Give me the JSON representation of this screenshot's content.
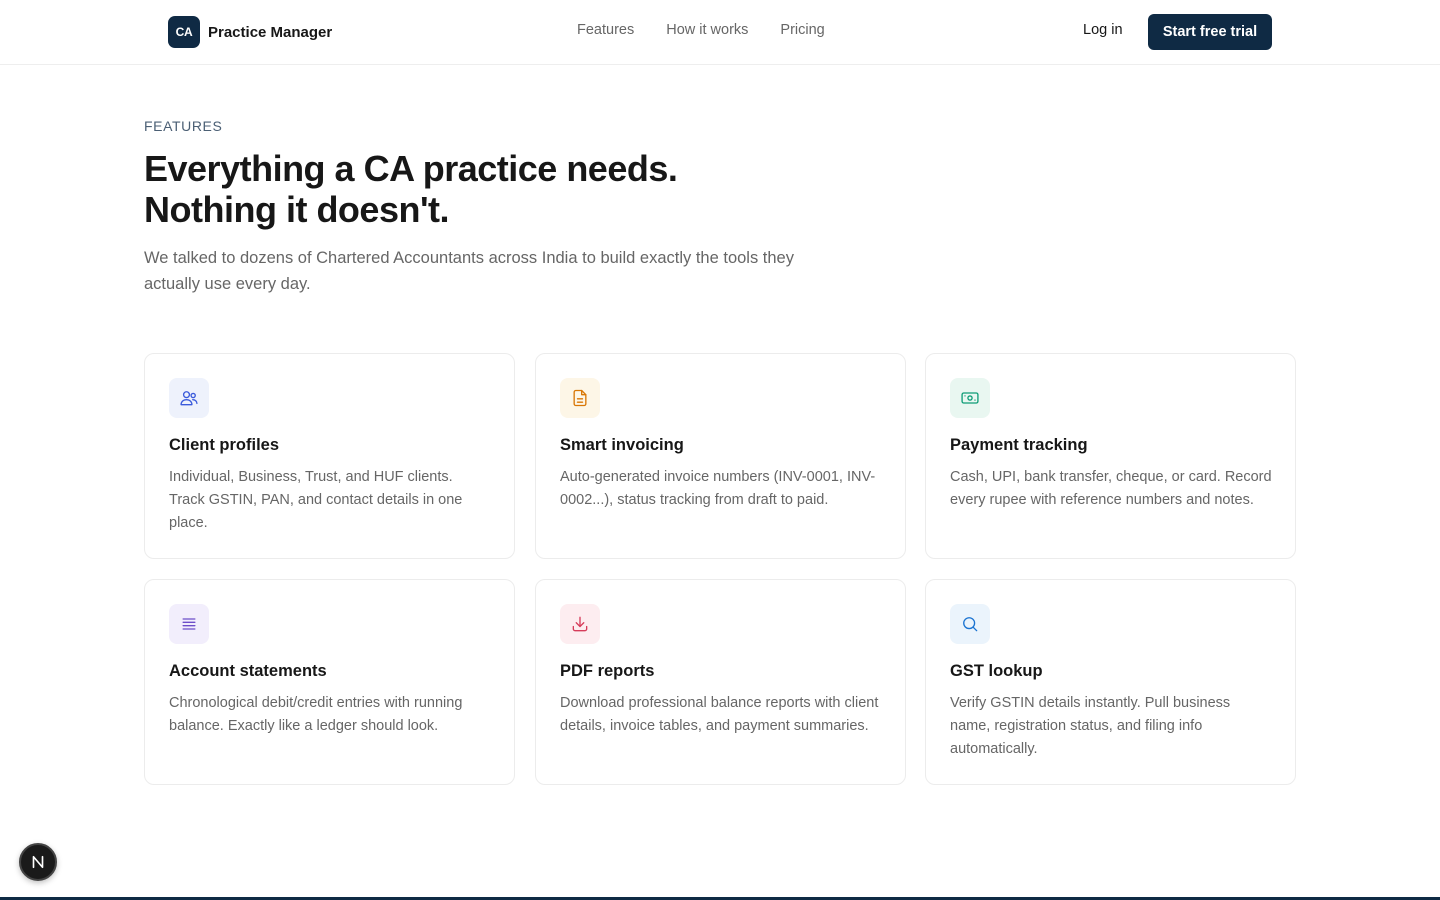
{
  "nav": {
    "brand_mark": "CA",
    "brand_name": "Practice Manager",
    "links": [
      "Features",
      "How it works",
      "Pricing"
    ],
    "login_label": "Log in",
    "cta_label": "Start free trial"
  },
  "hero": {
    "eyebrow": "FEATURES",
    "headline_line1": "Everything a CA practice needs.",
    "headline_line2": "Nothing it doesn't.",
    "subtext": "We talked to dozens of Chartered Accountants across India to build exactly the tools they actually use every day."
  },
  "features": [
    {
      "icon": "users-icon",
      "accent": "#3b5bdb",
      "icon_bg": "#eef2fc",
      "title": "Client profiles",
      "description": "Individual, Business, Trust, and HUF clients. Track GSTIN, PAN, and contact details in one place."
    },
    {
      "icon": "document-icon",
      "accent": "#d97706",
      "icon_bg": "#fdf6e7",
      "title": "Smart invoicing",
      "description": "Auto-generated invoice numbers (INV-0001, INV-0002...), status tracking from draft to paid."
    },
    {
      "icon": "banknote-icon",
      "accent": "#0f9d77",
      "icon_bg": "#e9f7f1",
      "title": "Payment tracking",
      "description": "Cash, UPI, bank transfer, cheque, or card. Record every rupee with reference numbers and notes."
    },
    {
      "icon": "list-icon",
      "accent": "#6d4ec9",
      "icon_bg": "#f2eefc",
      "title": "Account statements",
      "description": "Chronological debit/credit entries with running balance. Exactly like a ledger should look."
    },
    {
      "icon": "download-icon",
      "accent": "#d63c5a",
      "icon_bg": "#fdedf0",
      "title": "PDF reports",
      "description": "Download professional balance reports with client details, invoice tables, and payment summaries."
    },
    {
      "icon": "search-icon",
      "accent": "#1a73d1",
      "icon_bg": "#ebf4fc",
      "title": "GST lookup",
      "description": "Verify GSTIN details instantly. Pull business name, registration status, and filing info automatically."
    }
  ],
  "dev_badge": {
    "label": "N"
  }
}
